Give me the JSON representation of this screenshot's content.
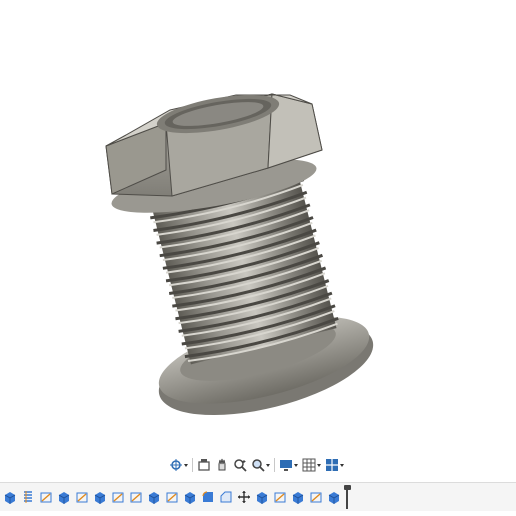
{
  "colors": {
    "background": "#ffffff",
    "nav_icon": "#2e6db4",
    "timeline_body": "#3a7bd5",
    "timeline_sketch": "#e08a1e",
    "timeline_marker": "#444444"
  },
  "viewport": {
    "model_name": "threaded-hex-fitting"
  },
  "nav_toolbar": {
    "buttons": [
      {
        "icon": "orbit-icon",
        "has_menu": true
      },
      {
        "icon": "look-at-icon",
        "has_menu": false
      },
      {
        "icon": "pan-icon",
        "has_menu": false
      },
      {
        "icon": "zoom-icon",
        "has_menu": false
      },
      {
        "icon": "zoom-window-icon",
        "has_menu": true
      },
      {
        "icon": "display-settings-icon",
        "has_menu": true
      },
      {
        "icon": "grid-settings-icon",
        "has_menu": true
      },
      {
        "icon": "viewports-icon",
        "has_menu": true
      }
    ]
  },
  "timeline": {
    "features": [
      {
        "type": "body",
        "icon": "extrude-icon"
      },
      {
        "type": "sketch",
        "icon": "thread-icon"
      },
      {
        "type": "sketch",
        "icon": "sketch-icon"
      },
      {
        "type": "body",
        "icon": "extrude-icon"
      },
      {
        "type": "sketch",
        "icon": "sketch-icon"
      },
      {
        "type": "body",
        "icon": "extrude-icon"
      },
      {
        "type": "sketch",
        "icon": "sketch-icon"
      },
      {
        "type": "sketch",
        "icon": "sketch-icon"
      },
      {
        "type": "body",
        "icon": "extrude-icon"
      },
      {
        "type": "sketch",
        "icon": "sketch-icon"
      },
      {
        "type": "body",
        "icon": "extrude-icon"
      },
      {
        "type": "fillet",
        "icon": "fillet-icon"
      },
      {
        "type": "fillet",
        "icon": "chamfer-icon"
      },
      {
        "type": "move",
        "icon": "move-icon"
      },
      {
        "type": "body",
        "icon": "extrude-icon"
      },
      {
        "type": "sketch",
        "icon": "sketch-icon"
      },
      {
        "type": "body",
        "icon": "extrude-icon"
      },
      {
        "type": "sketch",
        "icon": "sketch-icon"
      },
      {
        "type": "body",
        "icon": "extrude-icon"
      }
    ]
  }
}
